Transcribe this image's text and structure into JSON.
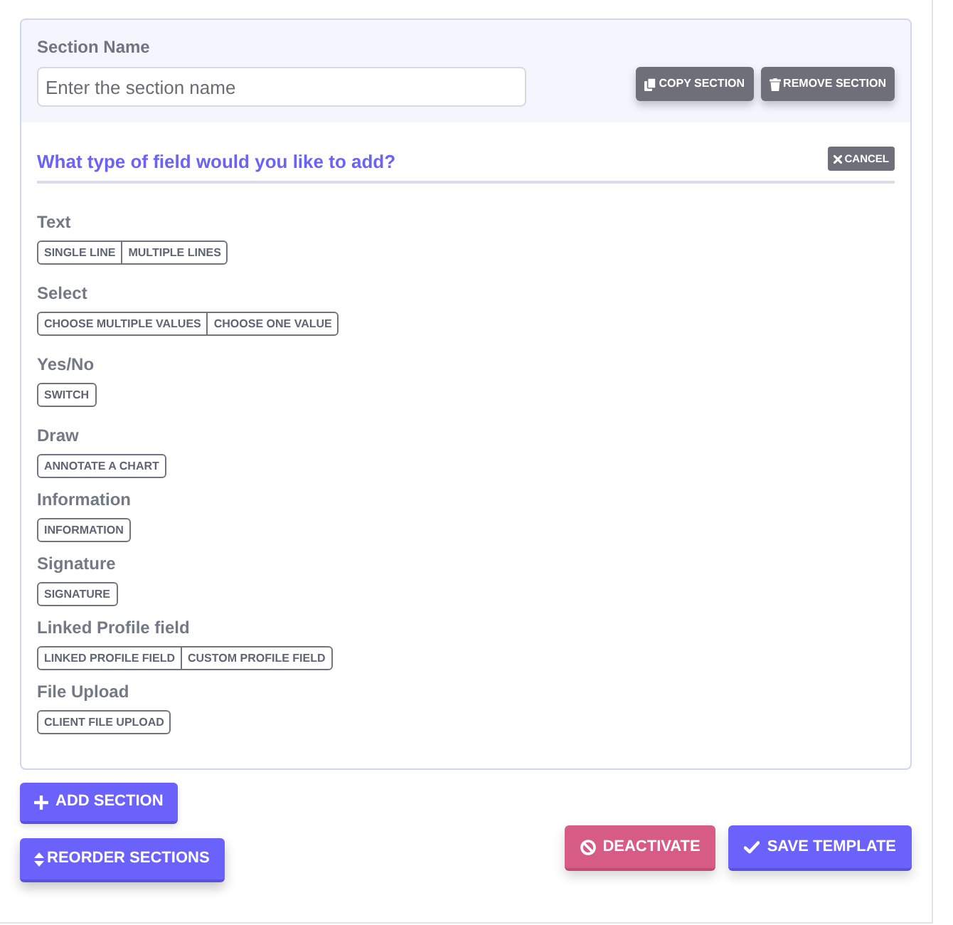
{
  "section": {
    "label": "Section Name",
    "placeholder": "Enter the section name",
    "copy_button": "COPY SECTION",
    "remove_button": "REMOVE SECTION"
  },
  "field_picker": {
    "title": "What type of field would you like to add?",
    "cancel_button": "CANCEL",
    "groups": [
      {
        "label": "Text",
        "options": [
          "SINGLE LINE",
          "MULTIPLE LINES"
        ]
      },
      {
        "label": "Select",
        "options": [
          "CHOOSE MULTIPLE VALUES",
          "CHOOSE ONE VALUE"
        ]
      },
      {
        "label": "Yes/No",
        "options": [
          "SWITCH"
        ]
      },
      {
        "label": "Draw",
        "options": [
          "ANNOTATE A CHART"
        ]
      },
      {
        "label": "Information",
        "options": [
          "INFORMATION"
        ]
      },
      {
        "label": "Signature",
        "options": [
          "SIGNATURE"
        ]
      },
      {
        "label": "Linked Profile field",
        "options": [
          "LINKED PROFILE FIELD",
          "CUSTOM PROFILE FIELD"
        ]
      },
      {
        "label": "File Upload",
        "options": [
          "CLIENT FILE UPLOAD"
        ]
      }
    ]
  },
  "actions": {
    "add_section_button": "ADD SECTION",
    "reorder_button": "REORDER SECTIONS",
    "deactivate_button": "DEACTIVATE",
    "save_button": "SAVE TEMPLATE"
  }
}
